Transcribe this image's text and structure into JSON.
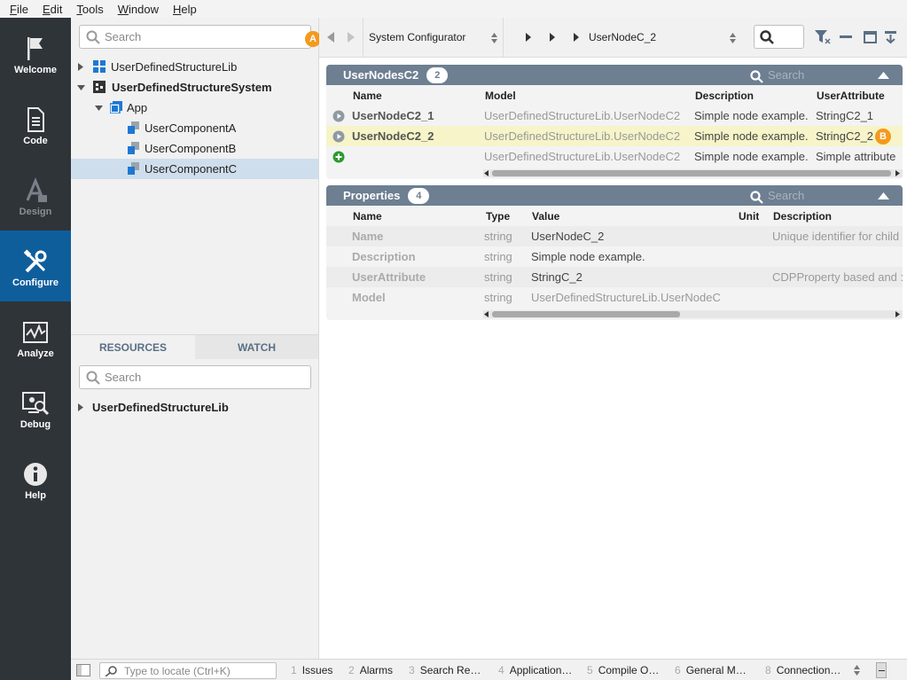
{
  "menu": [
    "File",
    "Edit",
    "Tools",
    "Window",
    "Help"
  ],
  "sidebar": [
    {
      "label": "Welcome",
      "icon": "flag-icon"
    },
    {
      "label": "Code",
      "icon": "document-icon"
    },
    {
      "label": "Design",
      "icon": "design-icon"
    },
    {
      "label": "Configure",
      "icon": "tools-icon"
    },
    {
      "label": "Analyze",
      "icon": "chart-icon"
    },
    {
      "label": "Debug",
      "icon": "debug-icon"
    },
    {
      "label": "Help",
      "icon": "info-icon"
    }
  ],
  "tree": {
    "search_placeholder": "Search",
    "items": [
      {
        "label": "UserDefinedStructureLib"
      },
      {
        "label": "UserDefinedStructureSystem"
      },
      {
        "label": "App"
      },
      {
        "label": "UserComponentA"
      },
      {
        "label": "UserComponentB"
      },
      {
        "label": "UserComponentC"
      }
    ],
    "marker_a": "A"
  },
  "resources": {
    "tabs": [
      "RESOURCES",
      "WATCH"
    ],
    "search_placeholder": "Search",
    "items": [
      "UserDefinedStructureLib"
    ]
  },
  "topbar": {
    "selector": "System Configurator",
    "breadcrumb": "UserNodeC_2"
  },
  "nodes_panel": {
    "title": "UserNodesC2",
    "count": "2",
    "search_placeholder": "Search",
    "columns": [
      "Name",
      "Model",
      "Description",
      "UserAttribute"
    ],
    "rows": [
      {
        "name": "UserNodeC2_1",
        "model": "UserDefinedStructureLib.UserNodeC2",
        "description": "Simple node example.",
        "attr": "StringC2_1"
      },
      {
        "name": "UserNodeC2_2",
        "model": "UserDefinedStructureLib.UserNodeC2",
        "description": "Simple node example.",
        "attr": "StringC2_2"
      },
      {
        "name": "",
        "model": "UserDefinedStructureLib.UserNodeC2",
        "description": "Simple node example.",
        "attr": "Simple attribute"
      }
    ],
    "marker_b": "B"
  },
  "props_panel": {
    "title": "Properties",
    "count": "4",
    "search_placeholder": "Search",
    "columns": [
      "Name",
      "Type",
      "Value",
      "Unit",
      "Description"
    ],
    "rows": [
      {
        "name": "Name",
        "type": "string",
        "value": "UserNodeC_2",
        "unit": "",
        "description": "Unique identifier for child"
      },
      {
        "name": "Description",
        "type": "string",
        "value": "Simple node example.",
        "unit": "",
        "description": ""
      },
      {
        "name": "UserAttribute",
        "type": "string",
        "value": "StringC_2",
        "unit": "",
        "description": "CDPProperty based and :"
      },
      {
        "name": "Model",
        "type": "string",
        "value": "UserDefinedStructureLib.UserNodeC",
        "unit": "",
        "description": ""
      }
    ]
  },
  "bottombar": {
    "locate_placeholder": "Type to locate (Ctrl+K)",
    "tabs": [
      {
        "n": "1",
        "label": "Issues"
      },
      {
        "n": "2",
        "label": "Alarms"
      },
      {
        "n": "3",
        "label": "Search Re…"
      },
      {
        "n": "4",
        "label": "Application…"
      },
      {
        "n": "5",
        "label": "Compile O…"
      },
      {
        "n": "6",
        "label": "General M…"
      },
      {
        "n": "8",
        "label": "Connection…"
      }
    ]
  }
}
